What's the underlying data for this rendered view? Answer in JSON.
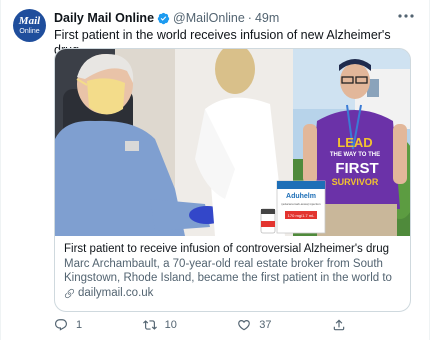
{
  "account": {
    "avatar_line1": "Mail",
    "avatar_line2": "Online",
    "name": "Daily Mail Online",
    "handle": "@MailOnline",
    "separator": "·",
    "time": "49m",
    "verified_color": "#1d9bf0",
    "brand_color": "#1f4e9c"
  },
  "tweet": {
    "text": "First patient in the world receives infusion of new Alzheimer's drug"
  },
  "card": {
    "title": "First patient to receive infusion of controversial Alzheimer's drug",
    "description": "Marc Archambault, a 70-year-old real estate broker from South Kingstown, Rhode Island, became the first patient in the world to be ...",
    "domain": "dailymail.co.uk",
    "image_text": {
      "shirt_line1": "LEAD",
      "shirt_line2": "THE WAY TO THE",
      "shirt_line3": "FIRST",
      "shirt_line4": "SURVIVOR",
      "box_brand": "Aduhelm",
      "box_sub": "(aducanumab-avwa) injection",
      "box_dose": "170 mg/1.7 mL"
    }
  },
  "actions": {
    "reply_count": "1",
    "retweet_count": "10",
    "like_count": "37"
  },
  "icons": [
    "verified-badge-icon",
    "more-icon",
    "link-icon",
    "reply-icon",
    "retweet-icon",
    "like-icon",
    "share-icon"
  ]
}
